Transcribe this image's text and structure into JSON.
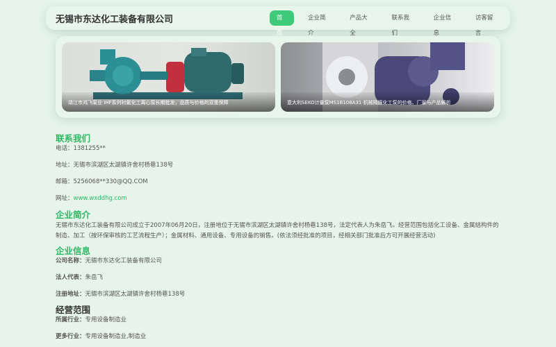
{
  "header": {
    "title": "无锡市东达化工装备有限公司",
    "nav": [
      "首页",
      "企业简介",
      "产品大全",
      "联系我们",
      "企业信息",
      "访客留言"
    ]
  },
  "hero": {
    "cards": [
      {
        "caption": "靖江市鸿飞泵业 IHF系列衬氟化工离心泵长期批发，品质与价格的双重保障"
      },
      {
        "caption": "意大利SEKO计量泵MS1B108A31 机械隔膜化工泵的价格、厂家与产品解析"
      }
    ]
  },
  "contact": {
    "title": "联系我们",
    "phone": "电话：1381255**",
    "address": "地址：无锡市滨湖区太湖镇许舍村杨巷138号",
    "email": "邮箱：5256068**330@QQ.COM",
    "website_label": "网址：",
    "website_url": "www.wxddhg.com"
  },
  "intro": {
    "title": "企业简介",
    "text": "无锡市东达化工装备有限公司成立于2007年06月20日，注册地位于无锡市滨湖区太湖镇许舍村杨巷138号，法定代表人为朱岳飞。经营范围包括化工设备、金属结构件的制造、加工（按环保审核的工艺流程生产）；金属材料、通用设备、专用设备的销售。(依法须经批准的项目，经相关部门批准后方可开展经营活动)"
  },
  "info": {
    "title": "企业信息",
    "company_label": "公司名称：",
    "company_value": "无锡市东达化工装备有限公司",
    "legal_label": "法人代表：",
    "legal_value": "朱岳飞",
    "reg_label": "注册地址：",
    "reg_value": "无锡市滨湖区太湖镇许舍村杨巷138号"
  },
  "scope": {
    "title": "经营范围",
    "industry_label": "所属行业：",
    "industry_value": "专用设备制造业",
    "more_label": "更多行业：",
    "more_value": "专用设备制造业,制造业"
  }
}
